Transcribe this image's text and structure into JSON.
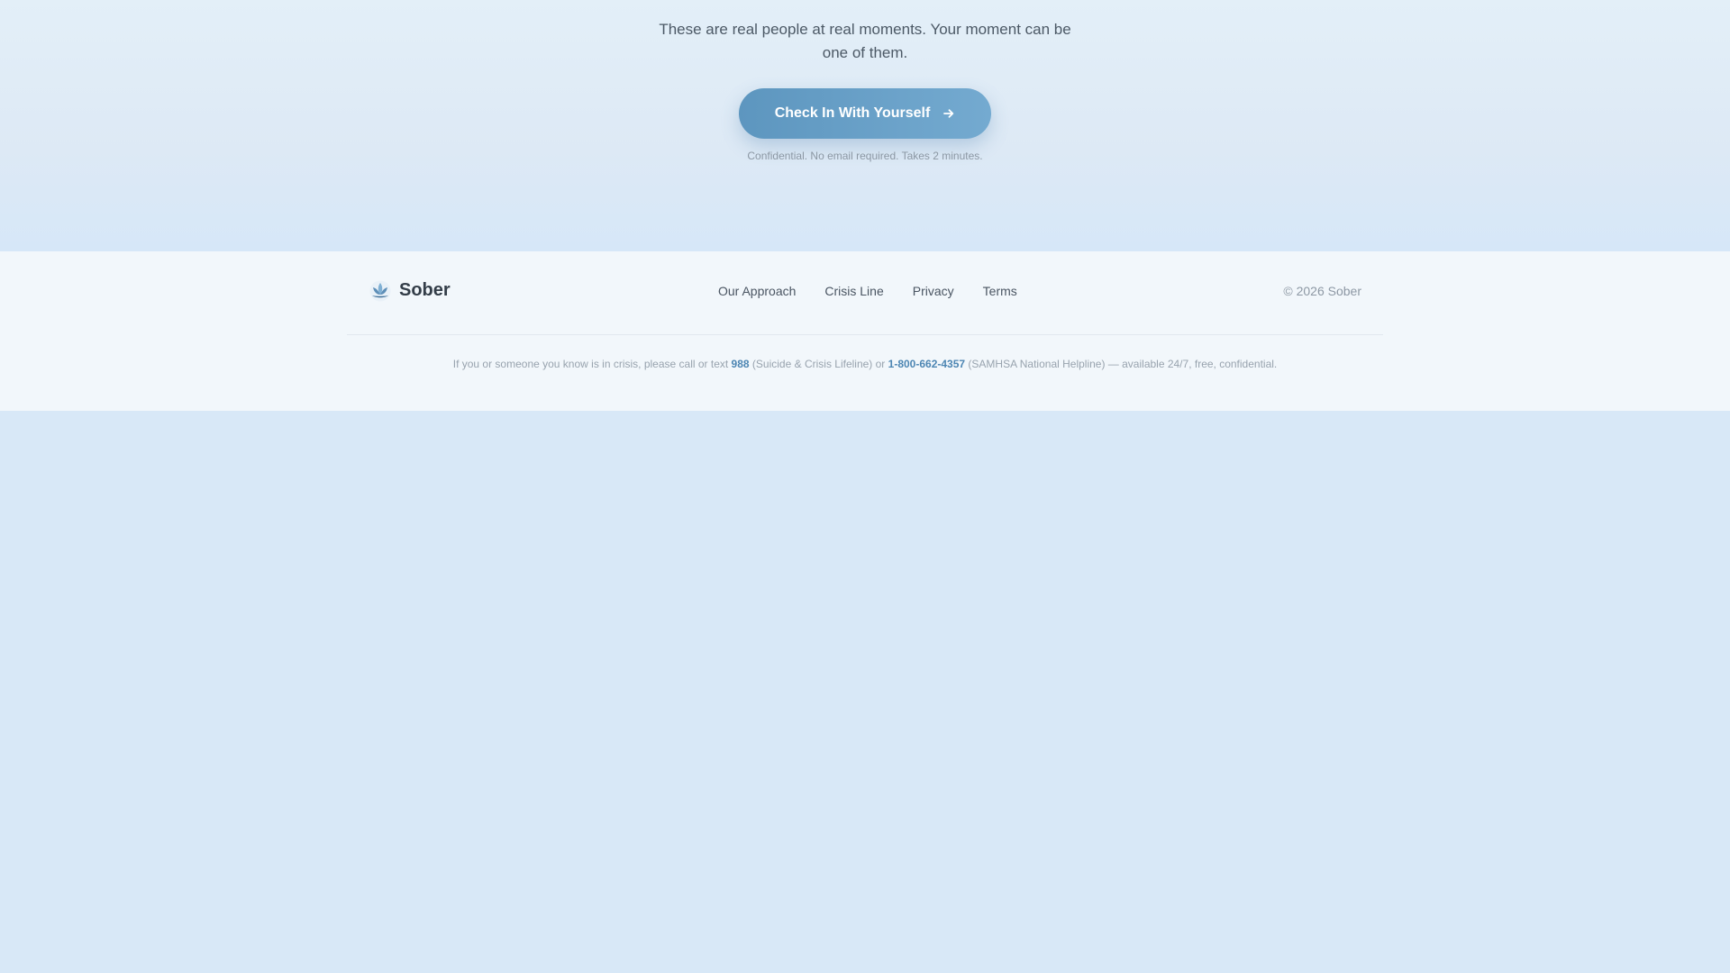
{
  "cta": {
    "tagline_line1": "These are real people at real moments. Your moment can be",
    "tagline_line2": "one of them.",
    "button_label": "Check In With Yourself",
    "button_icon": "arrow-right-icon",
    "note": "Confidential. No email required. Takes 2 minutes."
  },
  "footer": {
    "brand": {
      "name": "Sober",
      "icon": "lotus-icon"
    },
    "nav": [
      {
        "label": "Our Approach"
      },
      {
        "label": "Crisis Line"
      },
      {
        "label": "Privacy"
      },
      {
        "label": "Terms"
      }
    ],
    "copyright": "© 2026 Sober",
    "crisis": {
      "prefix": "If you or someone you know is in crisis, please call or text",
      "number1": "988",
      "middle": "(Suicide & Crisis Lifeline) or",
      "number2": "1-800-662-4357",
      "suffix": "(SAMHSA National Helpline) — available 24/7, free, confidential."
    }
  },
  "colors": {
    "accent": "#5d96bf",
    "link": "#4d86b3",
    "page_background": "#d8e8f7"
  }
}
